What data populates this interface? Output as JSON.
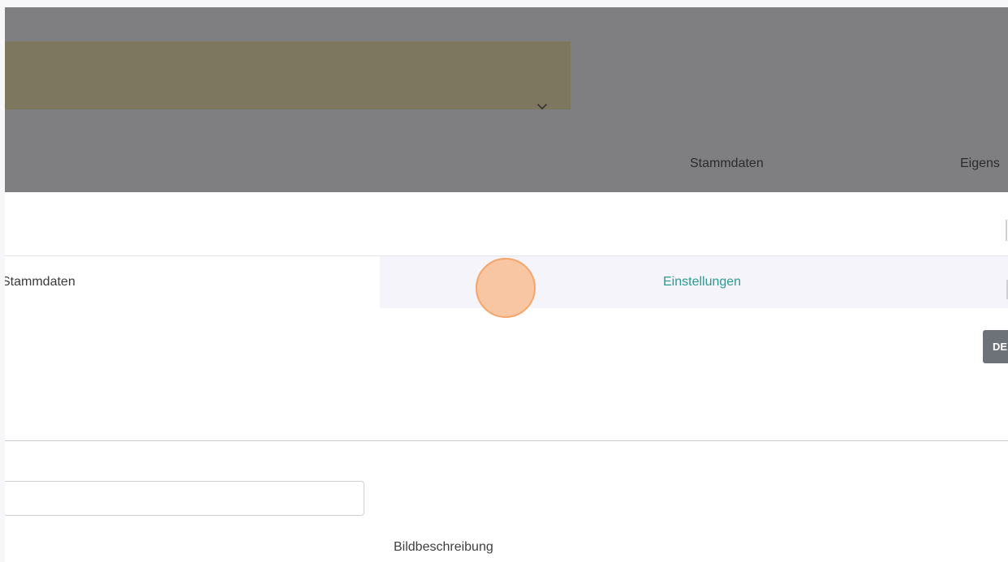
{
  "header": {
    "dropdown_icon": "chevron-down-icon",
    "tabs": [
      "Stammdaten",
      "Eigens"
    ]
  },
  "subtabs": {
    "left_label": "Stammdaten",
    "right_label": "Einstellungen"
  },
  "language_button": {
    "label": "DE"
  },
  "form": {
    "input_value": "",
    "bildbeschreibung_label": "Bildbeschreibung"
  },
  "colors": {
    "overlay": "#7f7f81",
    "dropdown_bg": "#7e775f",
    "accent_teal": "#2b9a94",
    "cursor_highlight": "#f8c19c"
  }
}
